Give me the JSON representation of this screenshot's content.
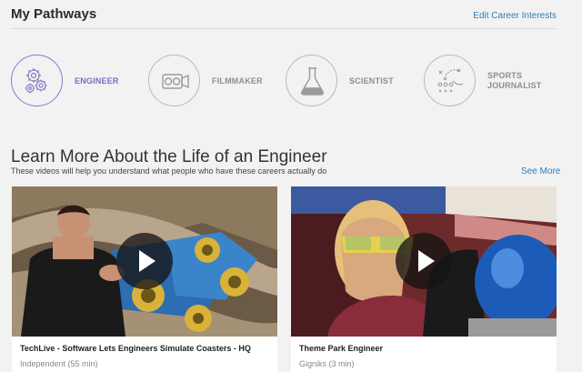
{
  "header": {
    "title": "My Pathways",
    "edit_link": "Edit Career Interests"
  },
  "pathways": [
    {
      "label": "ENGINEER",
      "icon": "gears-icon",
      "active": true
    },
    {
      "label": "FILMMAKER",
      "icon": "video-camera-icon",
      "active": false
    },
    {
      "label": "SCIENTIST",
      "icon": "flask-icon",
      "active": false
    },
    {
      "label": "SPORTS JOURNALIST",
      "icon": "play-diagram-icon",
      "active": false
    }
  ],
  "section": {
    "title": "Learn More About the Life of an Engineer",
    "subtitle": "These videos will help you understand what people who have these careers actually do",
    "see_more": "See More"
  },
  "videos": [
    {
      "title": "TechLive - Software Lets Engineers Simulate Coasters - HQ",
      "meta": "Independent (55 min)"
    },
    {
      "title": "Theme Park Engineer",
      "meta": "Gigniks (3 min)"
    }
  ],
  "colors": {
    "accent": "#7a6cc0",
    "link": "#2a7db8",
    "background": "#f2f2f2"
  }
}
